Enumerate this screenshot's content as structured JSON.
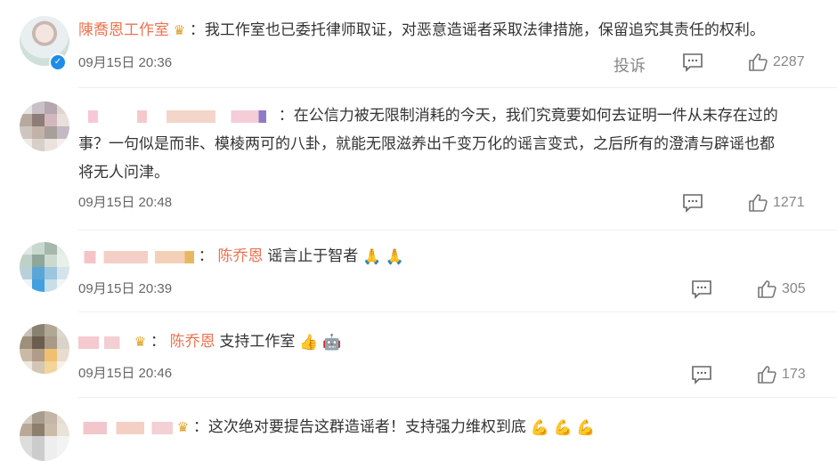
{
  "comments": [
    {
      "username": "陳喬恩工作室",
      "text": "：我工作室也已委托律师取证，对恶意造谣者采取法律措施，保留追究其责任的权利。",
      "time": "09月15日 20:36",
      "report_label": "投诉",
      "likes": "2287"
    },
    {
      "text_line1": "：在公信力被无限制消耗的今天，我们究竟要如何去证明一件从未存在过的",
      "text_line2": "事？一句似是而非、模棱两可的八卦，就能无限滋养出千变万化的谣言变式，之后所有的澄清与辟谣也都",
      "text_line3": "将无人问津。",
      "time": "09月15日 20:48",
      "likes": "1271"
    },
    {
      "reply_to": "陈乔恩",
      "text": "谣言止于智者",
      "emoji": "🙏 🙏",
      "time": "09月15日 20:39",
      "likes": "305"
    },
    {
      "reply_to": "陈乔恩",
      "text": "支持工作室",
      "emoji": "👍 🤖",
      "time": "09月15日 20:46",
      "likes": "173"
    },
    {
      "text": "：这次绝对要提告这群造谣者！支持强力维权到底",
      "emoji": "💪 💪 💪"
    }
  ],
  "icons": {
    "comment": "comment-icon",
    "like": "thumbs-up-icon",
    "verified": "verified-badge-icon",
    "crown": "vip-crown-icon"
  },
  "colors": {
    "username": "#eb7350",
    "verified": "#1e8ce8"
  }
}
